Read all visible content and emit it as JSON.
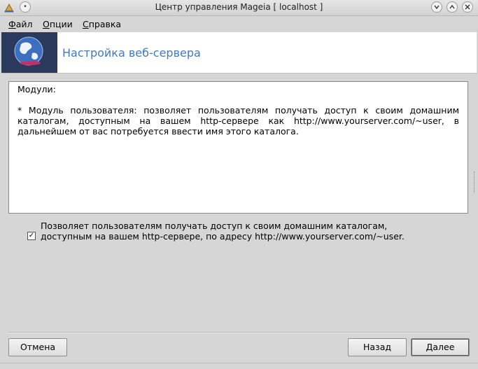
{
  "window": {
    "title": "Центр управления Mageia  [ localhost ]",
    "controls": [
      "minimize",
      "maximize",
      "close"
    ]
  },
  "menu": [
    {
      "accel": "Ф",
      "rest": "айл"
    },
    {
      "accel": "О",
      "rest": "пции"
    },
    {
      "accel": "С",
      "rest": "правка"
    }
  ],
  "banner": {
    "title": "Настройка веб-сервера"
  },
  "panel": {
    "heading": "Модули:",
    "text": "* Модуль пользователя: позволяет пользователям получать доступ к своим домашним каталогам, доступным на вашем http-сервере как http://www.yourserver.com/~user, в дальнейшем от вас потребуется ввести имя этого каталога."
  },
  "option": {
    "checked": true,
    "check_glyph": "✓",
    "label": "Позволяет пользователям получать доступ к своим домашним каталогам, доступным на вашем http-сервере, по адресу http://www.yourserver.com/~user."
  },
  "buttons": {
    "cancel": "Отмена",
    "back": "Назад",
    "next": "Далее"
  }
}
